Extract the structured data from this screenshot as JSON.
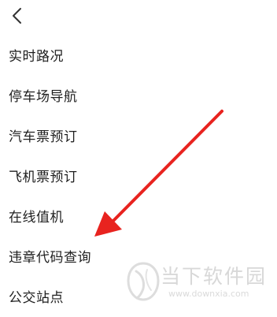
{
  "header": {
    "back_icon": "chevron-left-icon"
  },
  "menu": {
    "items": [
      {
        "label": "实时路况"
      },
      {
        "label": "停车场导航"
      },
      {
        "label": "汽车票预订"
      },
      {
        "label": "飞机票预订"
      },
      {
        "label": "在线值机"
      },
      {
        "label": "违章代码查询"
      },
      {
        "label": "公交站点"
      }
    ]
  },
  "annotation": {
    "arrow_color": "#e8231f",
    "arrow_icon": "red-arrow-annotation"
  },
  "watermark": {
    "title": "当下软件园",
    "url": "www.downxia.com"
  }
}
